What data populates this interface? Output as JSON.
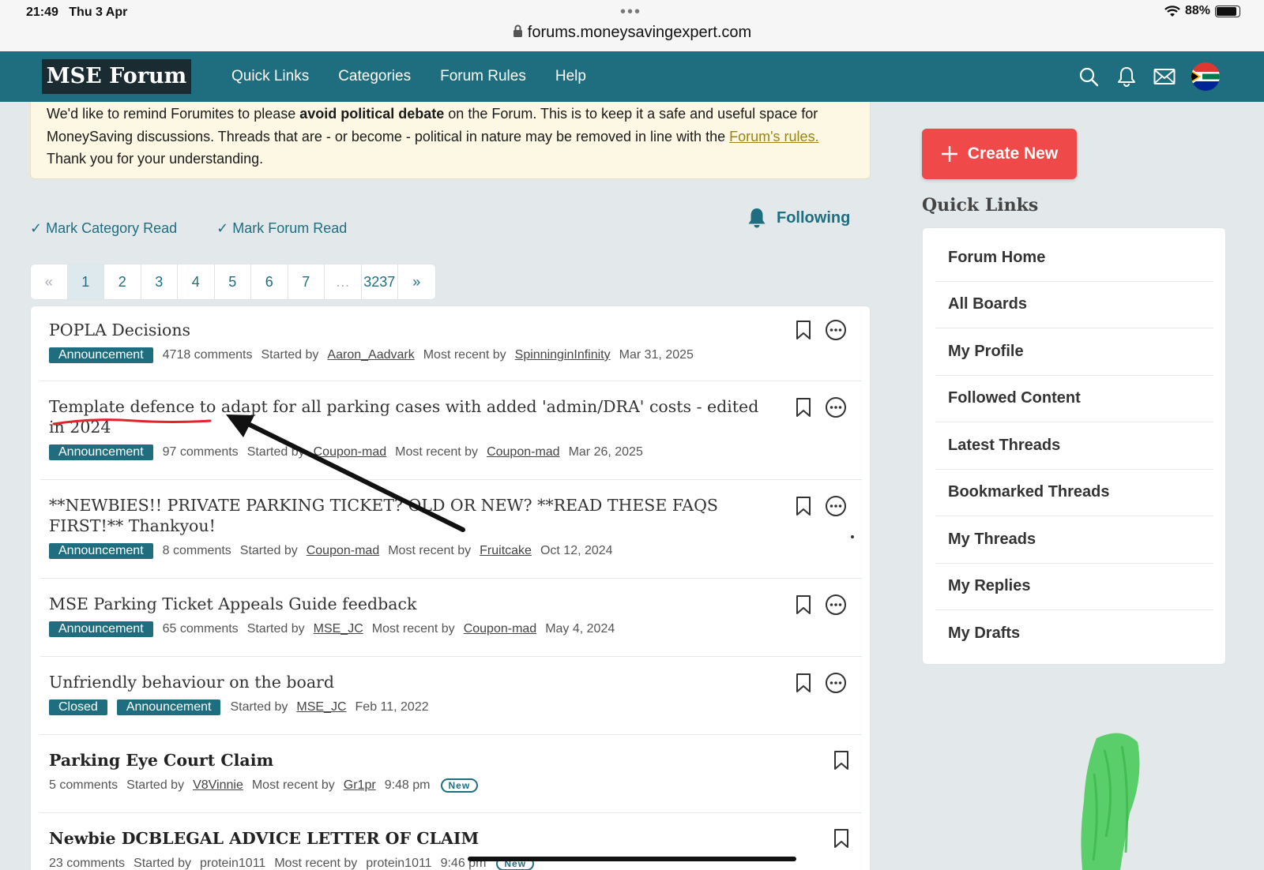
{
  "status": {
    "time": "21:49",
    "date": "Thu 3 Apr",
    "battery": "88%",
    "url": "forums.moneysavingexpert.com"
  },
  "nav": {
    "logo": "MSE Forum",
    "links": [
      "Quick Links",
      "Categories",
      "Forum Rules",
      "Help"
    ]
  },
  "notice": {
    "p1": "We'd like to remind Forumites to please ",
    "bold": "avoid political debate",
    "p2": " on the Forum. This is to keep it a safe and useful space for MoneySaving discussions. Threads that are - or become - political in nature may be removed in line with the ",
    "link": "Forum's rules.",
    "p3": " Thank you for your understanding."
  },
  "actions": {
    "mark_category": "Mark Category Read",
    "mark_forum": "Mark Forum Read",
    "following": "Following"
  },
  "pager": {
    "prev": "«",
    "pages": [
      "1",
      "2",
      "3",
      "4",
      "5",
      "6",
      "7"
    ],
    "ellipsis": "…",
    "last": "3237",
    "next": "»",
    "current": "1"
  },
  "threads": [
    {
      "title": "POPLA Decisions",
      "tags": [
        "Announcement"
      ],
      "comments": "4718 comments",
      "started_label": "Started by",
      "started_by": "Aaron_Aadvark",
      "recent_label": "Most recent by",
      "recent_by": "SpinninginInfinity",
      "date": "Mar 31, 2025"
    },
    {
      "title": "Template defence to adapt for all parking cases with added 'admin/DRA' costs - edited in 2024",
      "tags": [
        "Announcement"
      ],
      "comments": "97 comments",
      "started_label": "Started by",
      "started_by": "Coupon-mad",
      "recent_label": "Most recent by",
      "recent_by": "Coupon-mad",
      "date": "Mar 26, 2025"
    },
    {
      "title": "**NEWBIES!! PRIVATE PARKING TICKET? OLD OR NEW? **READ THESE FAQS FIRST!** Thankyou!",
      "tags": [
        "Announcement"
      ],
      "comments": "8 comments",
      "started_label": "Started by",
      "started_by": "Coupon-mad",
      "recent_label": "Most recent by",
      "recent_by": "Fruitcake",
      "date": "Oct 12, 2024"
    },
    {
      "title": "MSE Parking Ticket Appeals Guide feedback",
      "tags": [
        "Announcement"
      ],
      "comments": "65 comments",
      "started_label": "Started by",
      "started_by": "MSE_JC",
      "recent_label": "Most recent by",
      "recent_by": "Coupon-mad",
      "date": "May 4, 2024"
    },
    {
      "title": "Unfriendly behaviour on the board",
      "tags": [
        "Closed",
        "Announcement"
      ],
      "started_label": "Started by",
      "started_by": "MSE_JC",
      "date": "Feb 11, 2022"
    },
    {
      "title": "Parking Eye Court Claim",
      "comments": "5 comments",
      "started_label": "Started by",
      "started_by": "V8Vinnie",
      "recent_label": "Most recent by",
      "recent_by": "Gr1pr",
      "date": "9:48 pm",
      "badge": "New"
    },
    {
      "title": "Newbie DCBLEGAL ADVICE LETTER OF CLAIM",
      "comments": "23 comments",
      "started_label": "Started by",
      "started_by": "protein1011",
      "recent_label": "Most recent by",
      "recent_by": "protein1011",
      "date": "9:46 pm",
      "badge": "New"
    }
  ],
  "sidebar": {
    "create": "Create New",
    "quick_links_title": "Quick Links",
    "links": [
      "Forum Home",
      "All Boards",
      "My Profile",
      "Followed Content",
      "Latest Threads",
      "Bookmarked Threads",
      "My Threads",
      "My Replies",
      "My Drafts"
    ]
  },
  "colors": {
    "nav": "#1f6e80",
    "accent_red": "#f0494a",
    "notice_bg": "#fdf8e4",
    "tag": "#1f6e80"
  }
}
